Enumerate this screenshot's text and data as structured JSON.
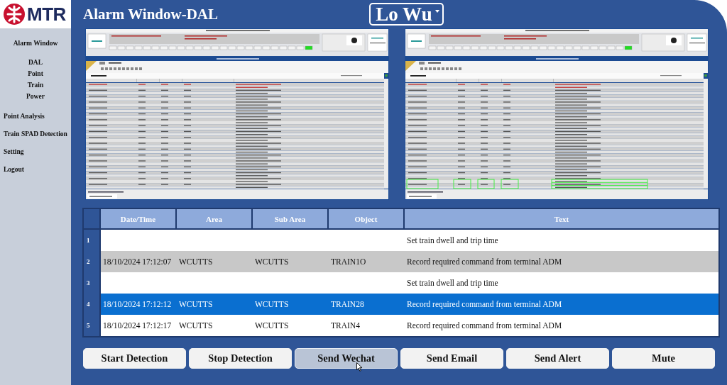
{
  "logo": {
    "text": "MTR"
  },
  "sidebar": {
    "items": [
      {
        "label": "Alarm Window",
        "children": [
          {
            "label": "DAL"
          },
          {
            "label": "Point"
          },
          {
            "label": "Train"
          },
          {
            "label": "Power"
          }
        ]
      },
      {
        "label": "Point Analysis"
      },
      {
        "label": "Train SPAD Detection"
      },
      {
        "label": "Setting"
      },
      {
        "label": "Logout"
      }
    ]
  },
  "header": {
    "title": "Alarm Window-DAL",
    "station_select": {
      "value": "Lo Wu"
    }
  },
  "screens": [
    {
      "highlight": false
    },
    {
      "highlight": true
    }
  ],
  "table": {
    "columns": [
      "Date/Time",
      "Area",
      "Sub Area",
      "Object",
      "Text"
    ],
    "rows": [
      {
        "number": "1",
        "text": "Set train dwell and trip time",
        "selected": false
      },
      {
        "number": "2",
        "date_time": "18/10/2024 17:12:07",
        "area": "WCUTTS",
        "sub_area": "WCUTTS",
        "object": "TRAIN1O",
        "text": "Record required command from terminal ADM",
        "selected": false
      },
      {
        "number": "3",
        "text": "Set train dwell and trip time",
        "selected": false
      },
      {
        "number": "4",
        "date_time": "18/10/2024 17:12:12",
        "area": "WCUTTS",
        "sub_area": "WCUTTS",
        "object": "TRAIN28",
        "text": "Record required command from terminal ADM",
        "selected": true
      },
      {
        "number": "5",
        "date_time": "18/10/2024 17:12:17",
        "area": "WCUTTS",
        "sub_area": "WCUTTS",
        "object": "TRAIN4",
        "text": "Record required command from terminal ADM",
        "selected": false
      }
    ]
  },
  "buttons": [
    {
      "label": "Start Detection",
      "hovered": false
    },
    {
      "label": "Stop Detection",
      "hovered": false
    },
    {
      "label": "Send Wechat",
      "hovered": true
    },
    {
      "label": "Send Email",
      "hovered": false
    },
    {
      "label": "Send Alert",
      "hovered": false
    },
    {
      "label": "Mute",
      "hovered": false
    }
  ]
}
